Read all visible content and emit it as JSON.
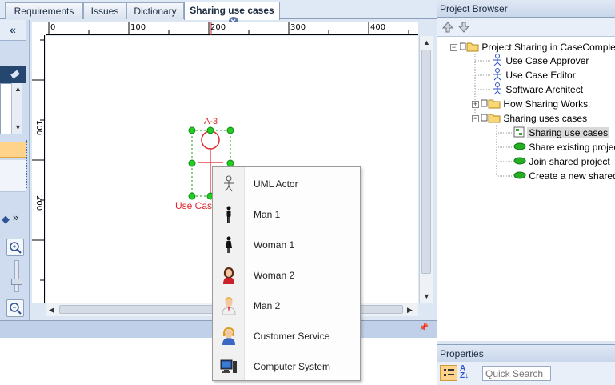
{
  "tabs": [
    {
      "label": "Requirements"
    },
    {
      "label": "Issues"
    },
    {
      "label": "Dictionary"
    },
    {
      "label": "Sharing use cases",
      "active": true
    }
  ],
  "left": {
    "collapse_glyph": "«"
  },
  "ruler": {
    "top_labels": [
      "0",
      "100",
      "200",
      "300",
      "400"
    ],
    "left_labels": [
      "100",
      "200"
    ]
  },
  "diagram": {
    "actor_id": "A-3",
    "actor_caption": "Use Cas"
  },
  "context_menu": {
    "items": [
      {
        "label": "UML Actor",
        "icon": "stick-figure-icon"
      },
      {
        "label": "Man 1",
        "icon": "man-silhouette-icon"
      },
      {
        "label": "Woman 1",
        "icon": "woman-silhouette-icon"
      },
      {
        "label": "Woman 2",
        "icon": "woman-avatar-icon"
      },
      {
        "label": "Man 2",
        "icon": "man-avatar-icon"
      },
      {
        "label": "Customer Service",
        "icon": "headset-icon"
      },
      {
        "label": "Computer System",
        "icon": "computer-icon"
      }
    ]
  },
  "project_browser": {
    "title": "Project Browser",
    "tree": [
      {
        "label": "Project Sharing in CaseComple",
        "icon": "folder-icon",
        "expander": "−"
      },
      {
        "label": "Use Case Approver",
        "icon": "actor-icon"
      },
      {
        "label": "Use Case Editor",
        "icon": "actor-icon"
      },
      {
        "label": "Software Architect",
        "icon": "actor-icon"
      },
      {
        "label": "How Sharing Works",
        "icon": "folder-icon",
        "expander": "+"
      },
      {
        "label": "Sharing uses cases",
        "icon": "folder-icon",
        "expander": "−"
      },
      {
        "label": "Sharing use cases",
        "icon": "diagram-icon",
        "selected": true
      },
      {
        "label": "Share existing projec",
        "icon": "usecase-icon"
      },
      {
        "label": "Join shared project",
        "icon": "usecase-icon"
      },
      {
        "label": "Create a new shared",
        "icon": "usecase-icon"
      }
    ]
  },
  "properties": {
    "title": "Properties",
    "search_placeholder": "Quick Search"
  },
  "colors": {
    "accent": "#2f5597",
    "selection_red": "#e0242b",
    "handle_green": "#22cc22"
  }
}
